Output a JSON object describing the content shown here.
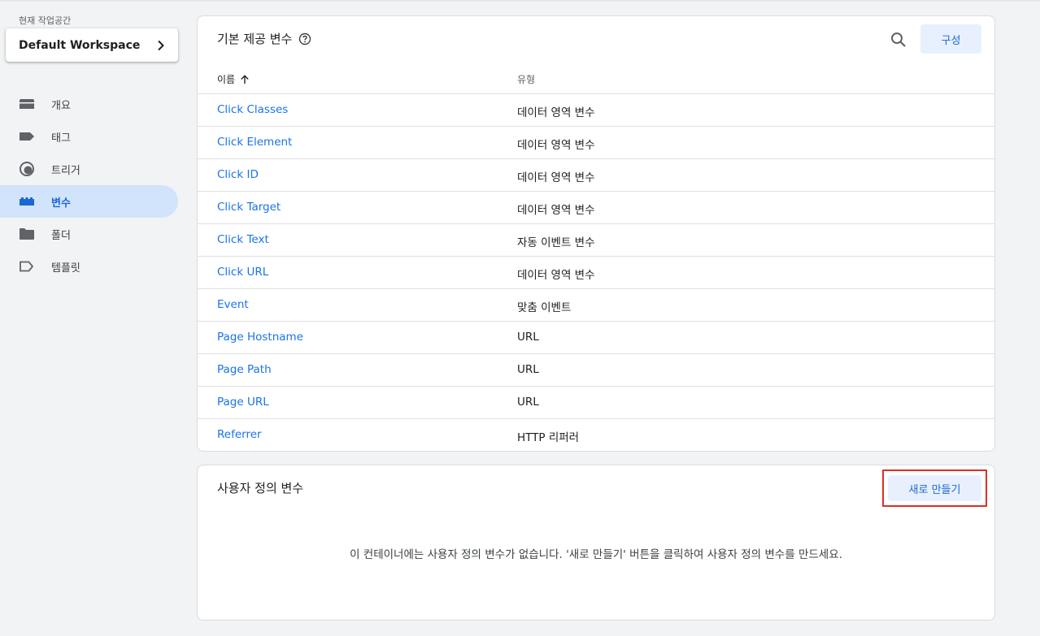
{
  "workspace": {
    "label": "현재 작업공간",
    "name": "Default Workspace"
  },
  "nav": [
    {
      "label": "개요",
      "icon": "overview-icon",
      "active": false
    },
    {
      "label": "태그",
      "icon": "tag-icon",
      "active": false
    },
    {
      "label": "트리거",
      "icon": "trigger-icon",
      "active": false
    },
    {
      "label": "변수",
      "icon": "variable-icon",
      "active": true
    },
    {
      "label": "폴더",
      "icon": "folder-icon",
      "active": false
    },
    {
      "label": "템플릿",
      "icon": "template-icon",
      "active": false
    }
  ],
  "builtin": {
    "title": "기본 제공 변수",
    "config_label": "구성",
    "col_name": "이름",
    "col_type": "유형",
    "rows": [
      {
        "name": "Click Classes",
        "type": "데이터 영역 변수"
      },
      {
        "name": "Click Element",
        "type": "데이터 영역 변수"
      },
      {
        "name": "Click ID",
        "type": "데이터 영역 변수"
      },
      {
        "name": "Click Target",
        "type": "데이터 영역 변수"
      },
      {
        "name": "Click Text",
        "type": "자동 이벤트 변수"
      },
      {
        "name": "Click URL",
        "type": "데이터 영역 변수"
      },
      {
        "name": "Event",
        "type": "맞춤 이벤트"
      },
      {
        "name": "Page Hostname",
        "type": "URL"
      },
      {
        "name": "Page Path",
        "type": "URL"
      },
      {
        "name": "Page URL",
        "type": "URL"
      },
      {
        "name": "Referrer",
        "type": "HTTP 리퍼러"
      }
    ]
  },
  "custom": {
    "title": "사용자 정의 변수",
    "new_label": "새로 만들기",
    "empty_message": "이 컨테이너에는 사용자 정의 변수가 없습니다. '새로 만들기' 버튼을 클릭하여 사용자 정의 변수를 만드세요."
  },
  "colors": {
    "accent": "#1a73e8",
    "active_bg": "#d2e3fc",
    "highlight": "#d93025"
  }
}
